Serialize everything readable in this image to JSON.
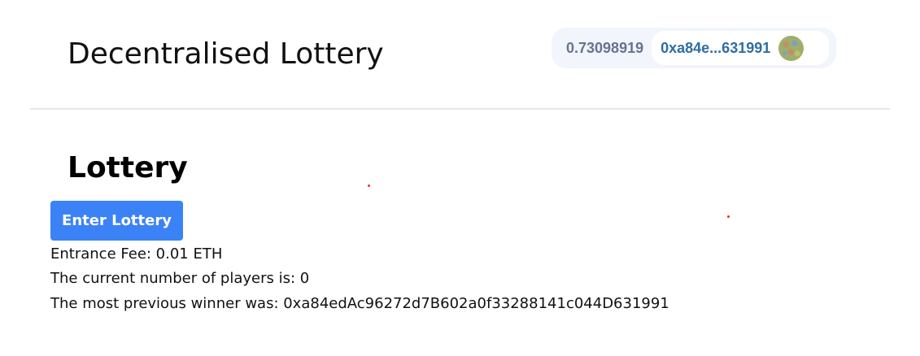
{
  "header": {
    "title": "Decentralised Lottery",
    "wallet": {
      "balance": "0.73098919",
      "address": "0xa84e...631991"
    }
  },
  "main": {
    "title": "Lottery",
    "enter_button_label": "Enter Lottery",
    "entrance_fee": "Entrance Fee: 0.01 ETH",
    "players_line": "The current number of players is: 0",
    "winner_line": "The most previous winner was: 0xa84edAc96272d7B602a0f33288141c044D631991"
  },
  "colors": {
    "primary_button": "#3b82f6",
    "wallet_bg": "#f2f5fb",
    "address_text": "#2e6da4",
    "balance_text": "#68738d"
  },
  "icons": {
    "avatar": "identicon-avatar"
  }
}
